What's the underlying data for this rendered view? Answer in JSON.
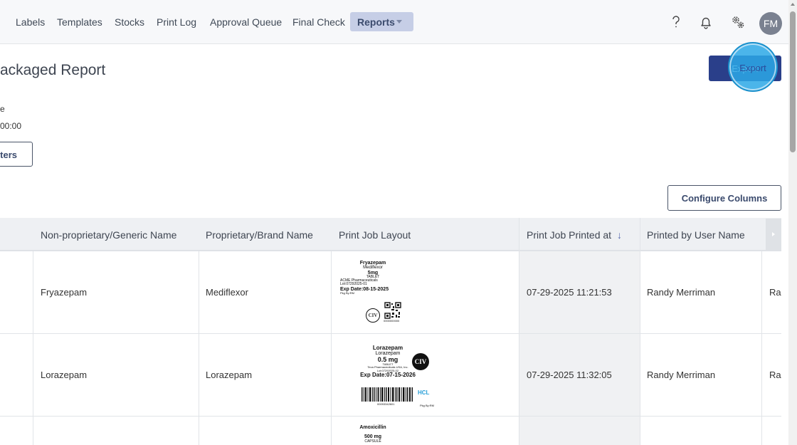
{
  "nav": {
    "items": [
      "Labels",
      "Templates",
      "Stocks",
      "Print Log",
      "Approval Queue",
      "Final Check"
    ],
    "active": "Reports"
  },
  "header_icons": [
    "help-icon",
    "bell-icon",
    "settings-gear-icon"
  ],
  "avatar": "FM",
  "page": {
    "title": "ackaged Report",
    "sub_label": "e",
    "sub_value": "00:00",
    "parameters_label": "eters",
    "export_label": "Export",
    "configure_columns_label": "Configure Columns"
  },
  "table": {
    "columns": [
      "Non-proprietary/Generic Name",
      "Proprietary/Brand Name",
      "Print Job Layout",
      "Print Job Printed at",
      "Printed by User Name"
    ],
    "sort_indicator": "↓",
    "rows": [
      {
        "generic": "Fryazepam",
        "brand": "Mediflexor",
        "printed_at": "07-29-2025 11:21:53",
        "user": "Randy Merriman",
        "next_col": "Ra"
      },
      {
        "generic": "Lorazepam",
        "brand": "Lorazepam",
        "printed_at": "07-29-2025 11:32:05",
        "user": "Randy Merriman",
        "next_col": "Ra"
      },
      {
        "generic": "",
        "brand": "",
        "printed_at": "",
        "user": "",
        "next_col": ""
      }
    ]
  },
  "labels": {
    "l1": {
      "name": "Fryazepam",
      "brand": "Mediflexor",
      "strength": "5mg",
      "form": "TABLET",
      "mfr": "ACME Pharmaceuticals",
      "lot": "Lot:07292025-01",
      "exp": "Exp Date:08-15-2025",
      "pkg": "Pkg By:RM",
      "schedule": "CIV",
      "code": "0000000000"
    },
    "l2": {
      "name": "Lorazepam",
      "brand": "Lorazepam",
      "strength": "0.5 mg",
      "form": "TABLET",
      "mfr": "Teva Pharmaceuticals USA, Inc.",
      "lot": "Lot:07292025-02",
      "exp": "Exp Date:07-15-2026",
      "schedule": "CIV",
      "code": "00093342601",
      "pkg": "Pkg By:RM",
      "logo": "HCL"
    },
    "l3": {
      "name": "Amoxicillin",
      "strength": "500 mg",
      "form": "CAPSULE"
    }
  },
  "colors": {
    "accent": "#2a3f8a",
    "nav_active_bg": "#c6cee6",
    "click_ring": "#2ca8e6"
  }
}
